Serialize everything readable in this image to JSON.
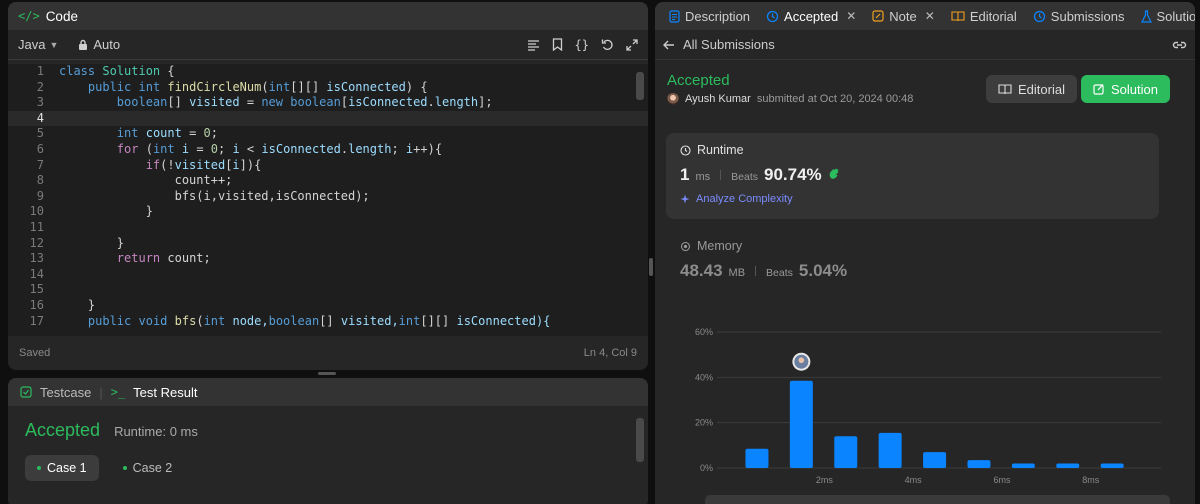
{
  "code_panel": {
    "title": "Code",
    "language": "Java",
    "mode": "Auto",
    "status_left": "Saved",
    "status_right": "Ln 4, Col 9",
    "lines": [
      "1",
      "2",
      "3",
      "4",
      "5",
      "6",
      "7",
      "8",
      "9",
      "10",
      "11",
      "12",
      "13",
      "14",
      "15",
      "16",
      "17"
    ]
  },
  "code_tokens": {
    "l1": [
      "class",
      "Solution",
      "{"
    ],
    "l2": [
      "public",
      "int",
      "findCircleNum",
      "int",
      "isConnected"
    ],
    "l3": [
      "boolean",
      "visited",
      "new",
      "boolean",
      "isConnected",
      "length"
    ],
    "l5": [
      "int",
      "count",
      "0"
    ],
    "l6": [
      "for",
      "int",
      "i",
      "0",
      "i",
      "isConnected",
      "length",
      "i"
    ],
    "l7": [
      "if",
      "visited",
      "i"
    ],
    "l8": [
      "count++;"
    ],
    "l9": [
      "bfs(i,visited,isConnected);"
    ],
    "l10": [
      "}"
    ],
    "l12": [
      "}"
    ],
    "l13": [
      "return",
      "count;"
    ],
    "l16": [
      "}"
    ],
    "l17": [
      "public",
      "void",
      "bfs",
      "int",
      "node,",
      "boolean",
      "visited,",
      "int",
      "isConnected){"
    ]
  },
  "test_panel": {
    "tab_testcase": "Testcase",
    "tab_result": "Test Result",
    "status": "Accepted",
    "runtime": "Runtime: 0 ms",
    "cases": [
      "Case 1",
      "Case 2"
    ]
  },
  "right_panel": {
    "tabs": [
      {
        "label": "Description"
      },
      {
        "label": "Accepted"
      },
      {
        "label": "Note"
      },
      {
        "label": "Editorial"
      },
      {
        "label": "Submissions"
      },
      {
        "label": "Solutions"
      }
    ],
    "back_label": "All Submissions",
    "submission": {
      "status": "Accepted",
      "user": "Ayush Kumar",
      "submitted": "submitted at Oct 20, 2024 00:48"
    },
    "buttons": {
      "editorial": "Editorial",
      "solution": "Solution"
    },
    "runtime": {
      "label": "Runtime",
      "value": "1",
      "unit": "ms",
      "beats_label": "Beats",
      "beats_value": "90.74%",
      "analyze": "Analyze Complexity"
    },
    "memory": {
      "label": "Memory",
      "value": "48.43",
      "unit": "MB",
      "beats_label": "Beats",
      "beats_value": "5.04%"
    }
  },
  "colors": {
    "accent_green": "#2cbb5d",
    "bar_blue": "#0a84ff",
    "analyze_purple": "#7a8cff"
  },
  "chart_data": {
    "type": "bar",
    "y_ticks": [
      "0%",
      "20%",
      "40%",
      "60%"
    ],
    "ylim": [
      0,
      60
    ],
    "x_tick_labels": [
      "2ms",
      "4ms",
      "6ms",
      "8ms"
    ],
    "x_ticks_at": [
      2,
      4,
      6,
      8
    ],
    "bars": [
      {
        "x": 1.0,
        "value": 8.5
      },
      {
        "x": 2.0,
        "value": 38.5
      },
      {
        "x": 3.0,
        "value": 14.0
      },
      {
        "x": 4.0,
        "value": 15.5
      },
      {
        "x": 5.0,
        "value": 7.0
      },
      {
        "x": 6.0,
        "value": 3.5
      },
      {
        "x": 7.0,
        "value": 2.0
      },
      {
        "x": 8.0,
        "value": 2.0
      },
      {
        "x": 9.0,
        "value": 2.0
      }
    ],
    "highlight_x": 2.0,
    "grid": true
  }
}
